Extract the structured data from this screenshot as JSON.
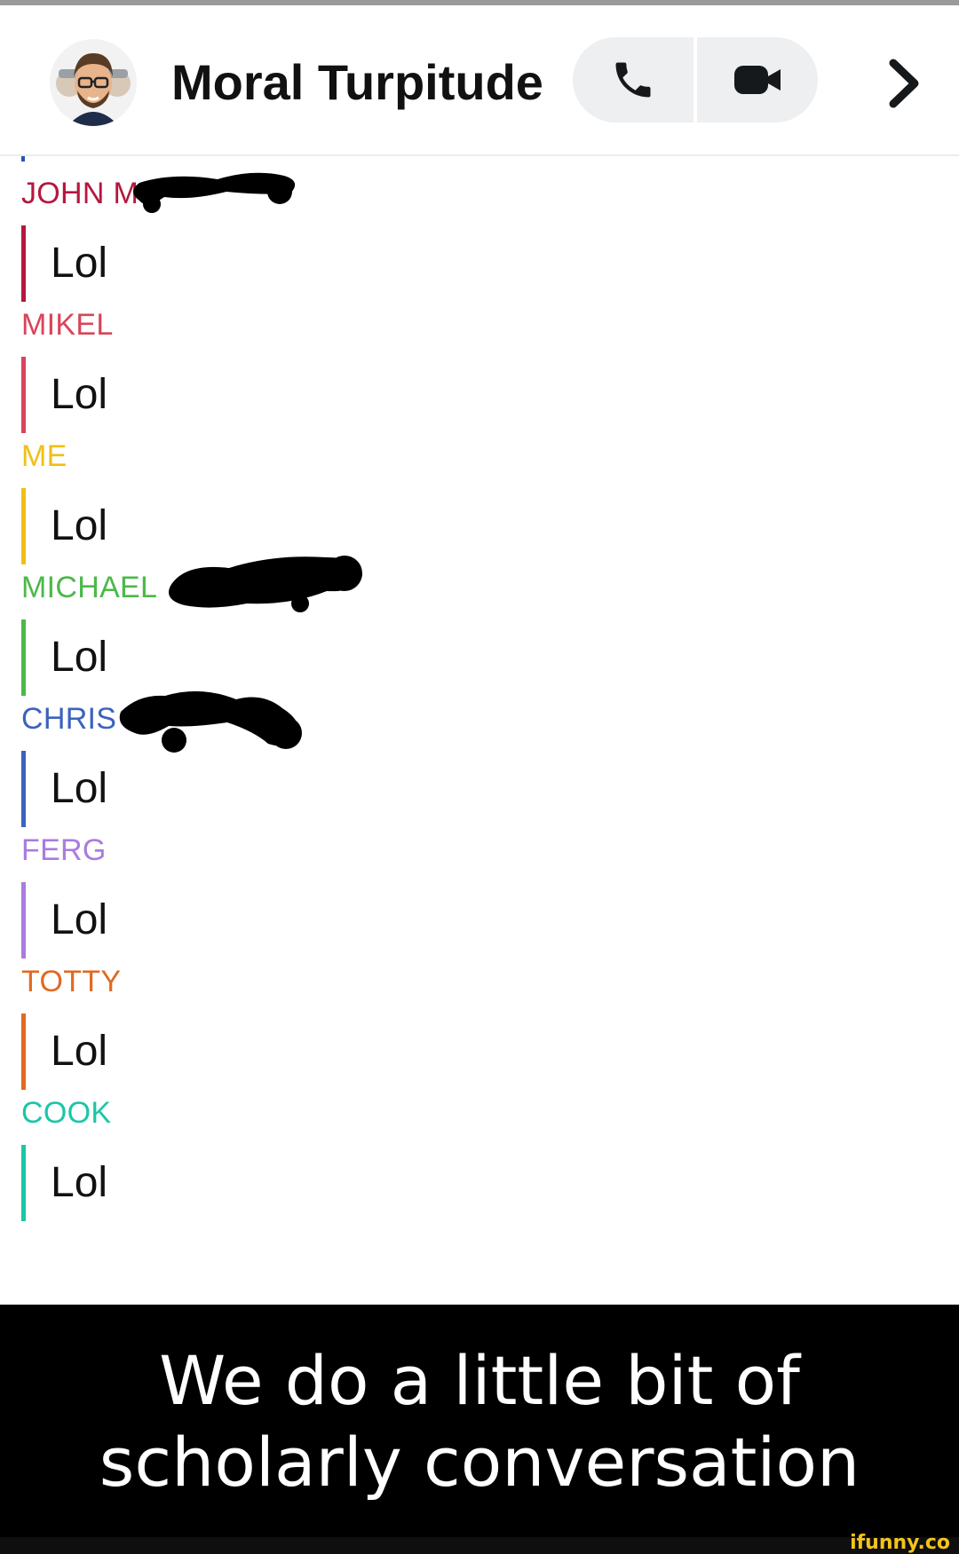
{
  "header": {
    "title": "Moral Turpitude",
    "avatar_icon": "bitmoji-group-avatar-icon",
    "call_icon": "phone-icon",
    "video_icon": "video-camera-icon",
    "more_icon": "chevron-right-icon"
  },
  "messages": [
    {
      "sender": "JOHN M",
      "text": "Lol",
      "color": "#b5173e",
      "redacted": true
    },
    {
      "sender": "MIKEL",
      "text": "Lol",
      "color": "#d9445a",
      "redacted": false
    },
    {
      "sender": "ME",
      "text": "Lol",
      "color": "#f0bf16",
      "redacted": false
    },
    {
      "sender": "MICHAEL",
      "text": "Lol",
      "color": "#4cb84a",
      "redacted": true
    },
    {
      "sender": "CHRIS",
      "text": "Lol",
      "color": "#3b63bd",
      "redacted": true
    },
    {
      "sender": "FERG",
      "text": "Lol",
      "color": "#a97ce0",
      "redacted": false
    },
    {
      "sender": "TOTTY",
      "text": "Lol",
      "color": "#e06a21",
      "redacted": false
    },
    {
      "sender": "COOK",
      "text": "Lol",
      "color": "#1cc6a6",
      "redacted": false
    }
  ],
  "caption": {
    "line1": "We do a little bit of",
    "line2": "scholarly conversation"
  },
  "watermark": "ifunny.co"
}
